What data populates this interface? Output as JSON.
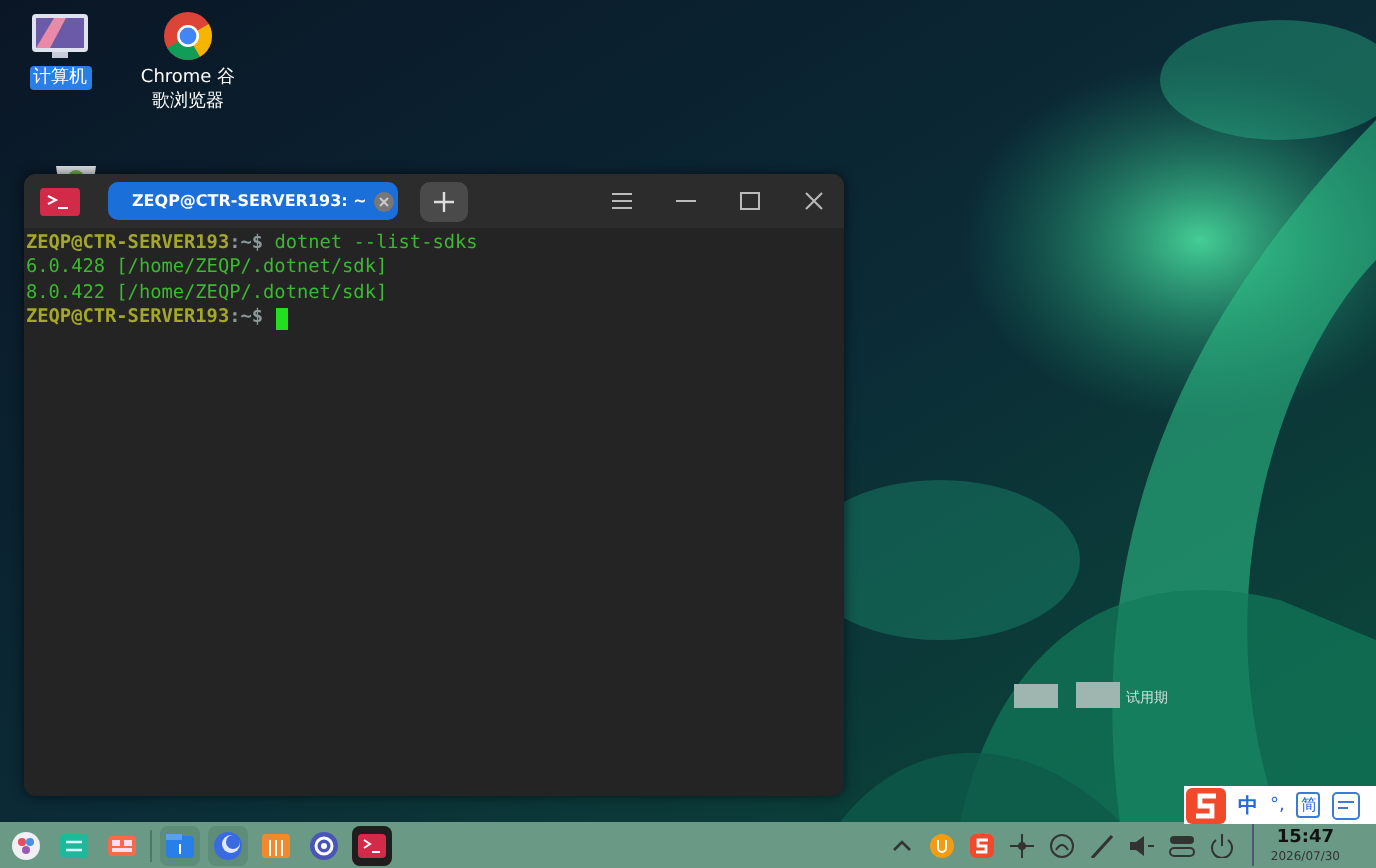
{
  "desktop": {
    "icons": [
      {
        "kind": "computer",
        "label": "计算机",
        "selected": true
      },
      {
        "kind": "chrome",
        "label": "Chrome 谷歌浏览器",
        "selected": false
      },
      {
        "kind": "trash"
      }
    ],
    "notice": "试用期"
  },
  "terminal": {
    "tab": {
      "title": "ZEQP@CTR-SERVER193: ~",
      "selected": true
    },
    "lines": [
      {
        "kind": "prompt",
        "user": "ZEQP@CTR-SERVER193",
        "path": ":~",
        "sign": "$",
        "command": " dotnet --list-sdks"
      },
      {
        "kind": "output",
        "text": "6.0.428 [/home/ZEQP/.dotnet/sdk]"
      },
      {
        "kind": "output",
        "text": "8.0.422 [/home/ZEQP/.dotnet/sdk]"
      },
      {
        "kind": "prompt",
        "user": "ZEQP@CTR-SERVER193",
        "path": ":~",
        "sign": "$",
        "cursor": true
      }
    ]
  },
  "taskbar": {
    "apps": [
      {
        "kind": "launcher",
        "open": false
      },
      {
        "kind": "multitask",
        "open": false
      },
      {
        "kind": "store",
        "open": false
      },
      {
        "kind": "files",
        "open": true
      },
      {
        "kind": "browser",
        "open": true
      },
      {
        "kind": "appstore",
        "open": false
      },
      {
        "kind": "settings",
        "open": false
      },
      {
        "kind": "terminal",
        "open": true
      }
    ],
    "clock": {
      "time": "15:47",
      "date": "2026/07/30"
    }
  },
  "ime": {
    "mode": "中",
    "punct": "°,",
    "script": "简"
  }
}
